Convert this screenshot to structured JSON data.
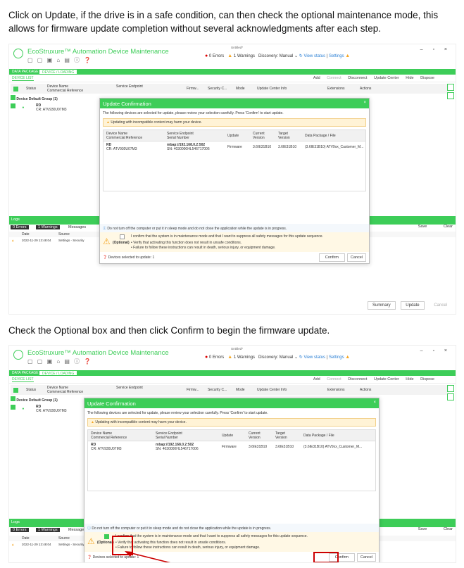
{
  "instructions": {
    "step1": "Click on Update, if the drive is in a safe condition, can then check the optional maintenance mode, this allows for firmware update completion without several acknowledgments after each step.",
    "step2": "Check the Optional box and then click Confirm to begin the firmware update."
  },
  "app": {
    "title": "EcoStruxure™ Automation Device Maintenance",
    "untitled": "Untitled*",
    "errors": "0 Errors",
    "warnings": "1 Warnings",
    "discovery": "Discovery: Manual",
    "view_status": "View status",
    "settings": "Settings"
  },
  "tabs": {
    "data_package": "DATA PACKAGE",
    "device_loading": "DEVICE / LOADING",
    "device_list": "DEVICE LIST"
  },
  "actions": [
    "Add",
    "Connect",
    "Disconnect",
    "Update Center",
    "Hide",
    "Dispose"
  ],
  "grid": {
    "status": "Status",
    "device_name": "Device Name",
    "commercial_reference": "Commercial Reference",
    "service_endpoint": "Service Endpoint",
    "firmware": "Firmw...",
    "security": "Security C...",
    "mode": "Mode",
    "update_center_info": "Update Center Info",
    "extensions": "Extensions",
    "actions": "Actions",
    "group": "Device Default Group (1)",
    "row_name": "RD",
    "row_cr": "CR:  ATV930U07M3"
  },
  "logs": {
    "title": "Logs",
    "errors": "0 Errors",
    "warnings": "1 Warnings",
    "messages": "Messages",
    "date": "Date",
    "source": "Source",
    "row_date": "2022-11-29 13:48:04",
    "row_source": "Settings - Security",
    "save": "Save",
    "clear": "Clear"
  },
  "bottom": {
    "summary": "Summary",
    "update": "Update",
    "cancel": "Cancel"
  },
  "modal": {
    "title": "Update Confirmation",
    "intro": "The following devices are selected for update, please review your selection carefully. Press 'Confirm' to start update.",
    "warning": "Updating with incompatible content may harm your device.",
    "headers": {
      "device_name": "Device Name",
      "commercial_reference": "Commercial Reference",
      "service_endpoint": "Service Endpoint",
      "serial_number": "Serial Number",
      "update": "Update",
      "current_version": "Current Version",
      "target_version": "Target Version",
      "data_package": "Data Package / File"
    },
    "row": {
      "name": "RD",
      "cr": "CR:  ATV930U07M3",
      "endpoint": "mbap://192.168.0.2:502",
      "sn": "SN:  4030000HL546717006",
      "update": "Firmware",
      "current": "3.6IE31B10",
      "target": "3.6IE31B10",
      "package": "(3.6IE31B10) ATV9xx_Customer_M..."
    },
    "info": "Do not turn off the computer or put it in sleep mode and do not close the application while the update is in progress.",
    "optional_label": "(Optional)",
    "optional_text": "I confirm that the system is in maintenance mode and that I want to suppress all safety messages for this update sequence.",
    "bullet1": "Verify that activating this function does not result in unsafe conditions.",
    "bullet2": "Failure to follow these instructions can result in death, serious injury, or equipment damage.",
    "selected": "Devices selected to update: 1",
    "confirm": "Confirm",
    "cancel": "Cancel"
  }
}
